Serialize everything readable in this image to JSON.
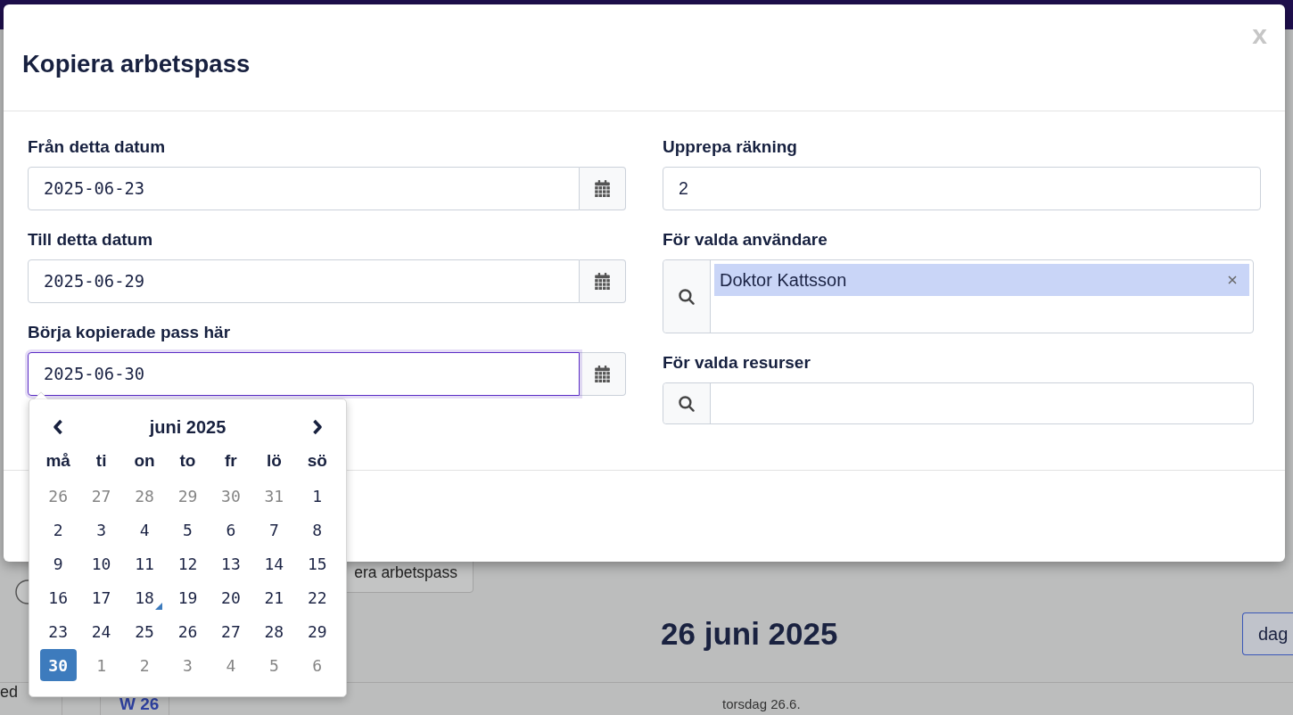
{
  "background": {
    "copy_button": "era arbetspass",
    "date_heading": "26 juni 2025",
    "view_button": "dag",
    "side_text": "ed",
    "week_label": "W 26",
    "day_header": "torsdag 26.6."
  },
  "modal": {
    "title": "Kopiera arbetspass",
    "close_label": "x",
    "left_column": [
      {
        "kind": "date",
        "label": "Från detta datum",
        "value": "2025-06-23",
        "focused": false
      },
      {
        "kind": "date",
        "label": "Till detta datum",
        "value": "2025-06-29",
        "focused": false
      },
      {
        "kind": "date",
        "label": "Börja kopierade pass här",
        "value": "2025-06-30",
        "focused": true
      }
    ],
    "right_column": [
      {
        "kind": "number",
        "label": "Upprepa räkning",
        "value": "2",
        "focused": false
      },
      {
        "kind": "multiselect",
        "label": "För valda användare",
        "tags": [
          "Doktor Kattsson"
        ],
        "focused": false
      },
      {
        "kind": "multiselect",
        "label": "För valda resurser",
        "focused": false
      }
    ],
    "datepicker": {
      "month_label": "juni 2025",
      "weekdays": [
        "må",
        "ti",
        "on",
        "to",
        "fr",
        "lö",
        "sö"
      ],
      "days": [
        {
          "label": "26",
          "outside": true,
          "selected": false,
          "today": false
        },
        {
          "label": "27",
          "outside": true,
          "selected": false,
          "today": false
        },
        {
          "label": "28",
          "outside": true,
          "selected": false,
          "today": false
        },
        {
          "label": "29",
          "outside": true,
          "selected": false,
          "today": false
        },
        {
          "label": "30",
          "outside": true,
          "selected": false,
          "today": false
        },
        {
          "label": "31",
          "outside": true,
          "selected": false,
          "today": false
        },
        {
          "label": "1",
          "outside": false,
          "selected": false,
          "today": false
        },
        {
          "label": "2",
          "outside": false,
          "selected": false,
          "today": false
        },
        {
          "label": "3",
          "outside": false,
          "selected": false,
          "today": false
        },
        {
          "label": "4",
          "outside": false,
          "selected": false,
          "today": false
        },
        {
          "label": "5",
          "outside": false,
          "selected": false,
          "today": false
        },
        {
          "label": "6",
          "outside": false,
          "selected": false,
          "today": false
        },
        {
          "label": "7",
          "outside": false,
          "selected": false,
          "today": false
        },
        {
          "label": "8",
          "outside": false,
          "selected": false,
          "today": false
        },
        {
          "label": "9",
          "outside": false,
          "selected": false,
          "today": false
        },
        {
          "label": "10",
          "outside": false,
          "selected": false,
          "today": false
        },
        {
          "label": "11",
          "outside": false,
          "selected": false,
          "today": false
        },
        {
          "label": "12",
          "outside": false,
          "selected": false,
          "today": false
        },
        {
          "label": "13",
          "outside": false,
          "selected": false,
          "today": false
        },
        {
          "label": "14",
          "outside": false,
          "selected": false,
          "today": false
        },
        {
          "label": "15",
          "outside": false,
          "selected": false,
          "today": false
        },
        {
          "label": "16",
          "outside": false,
          "selected": false,
          "today": false
        },
        {
          "label": "17",
          "outside": false,
          "selected": false,
          "today": false
        },
        {
          "label": "18",
          "outside": false,
          "selected": false,
          "today": true
        },
        {
          "label": "19",
          "outside": false,
          "selected": false,
          "today": false
        },
        {
          "label": "20",
          "outside": false,
          "selected": false,
          "today": false
        },
        {
          "label": "21",
          "outside": false,
          "selected": false,
          "today": false
        },
        {
          "label": "22",
          "outside": false,
          "selected": false,
          "today": false
        },
        {
          "label": "23",
          "outside": false,
          "selected": false,
          "today": false
        },
        {
          "label": "24",
          "outside": false,
          "selected": false,
          "today": false
        },
        {
          "label": "25",
          "outside": false,
          "selected": false,
          "today": false
        },
        {
          "label": "26",
          "outside": false,
          "selected": false,
          "today": false
        },
        {
          "label": "27",
          "outside": false,
          "selected": false,
          "today": false
        },
        {
          "label": "28",
          "outside": false,
          "selected": false,
          "today": false
        },
        {
          "label": "29",
          "outside": false,
          "selected": false,
          "today": false
        },
        {
          "label": "30",
          "outside": false,
          "selected": true,
          "today": false
        },
        {
          "label": "1",
          "outside": true,
          "selected": false,
          "today": false
        },
        {
          "label": "2",
          "outside": true,
          "selected": false,
          "today": false
        },
        {
          "label": "3",
          "outside": true,
          "selected": false,
          "today": false
        },
        {
          "label": "4",
          "outside": true,
          "selected": false,
          "today": false
        },
        {
          "label": "5",
          "outside": true,
          "selected": false,
          "today": false
        },
        {
          "label": "6",
          "outside": true,
          "selected": false,
          "today": false
        }
      ]
    }
  }
}
